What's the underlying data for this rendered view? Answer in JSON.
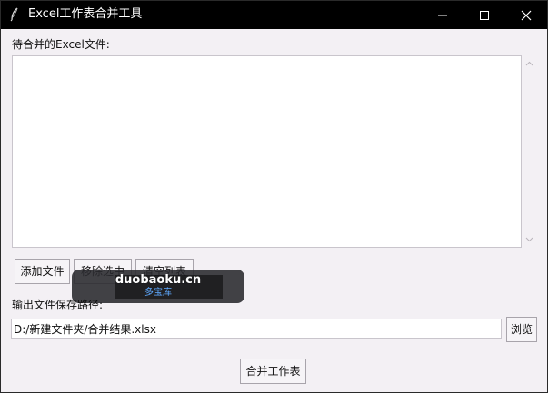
{
  "window": {
    "title": "Excel工作表合并工具",
    "controls": [
      "minimize",
      "maximize",
      "close"
    ]
  },
  "file_list": {
    "label": "待合并的Excel文件:",
    "items": []
  },
  "actions": {
    "add_label": "添加文件",
    "remove_label": "移除选中",
    "clear_label": "清空列表"
  },
  "output": {
    "label": "输出文件保存路径:",
    "path_value": "D:/新建文件夹/合并结果.xlsx",
    "browse_label": "浏览"
  },
  "merge": {
    "label": "合并工作表"
  },
  "watermark": {
    "main": "duobaoku.cn",
    "sub": "多宝库"
  },
  "colors": {
    "titlebar": "#000000",
    "window_bg": "#f3f0f4",
    "watermark_bg": "#28282c",
    "watermark_sub": "#5ea9ff"
  }
}
